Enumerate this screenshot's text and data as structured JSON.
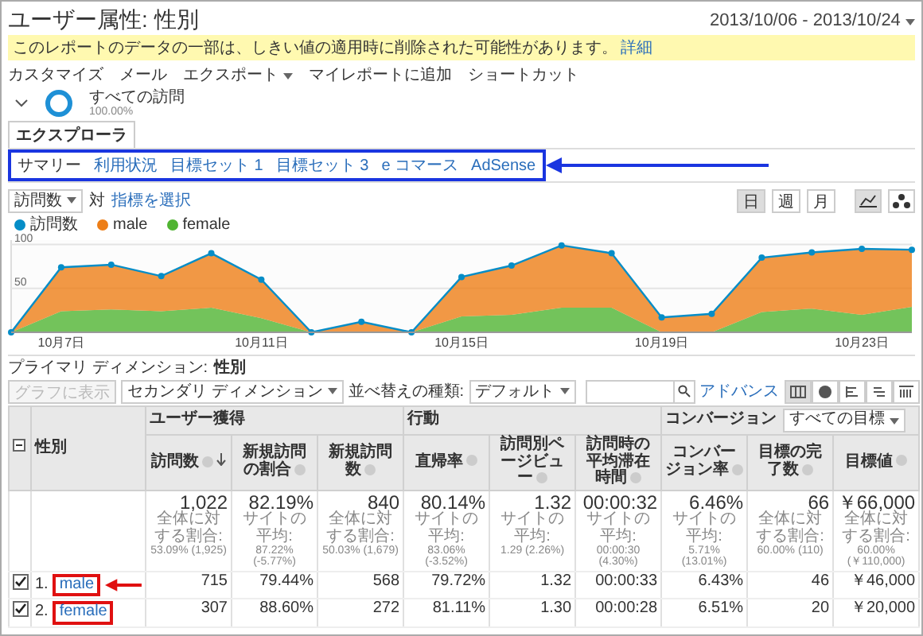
{
  "window_title": "ユーザー属性: 性別",
  "date_range": "2013/10/06 - 2013/10/24",
  "notice": {
    "text": "このレポートのデータの一部は、しきい値の適用時に削除された可能性があります。",
    "link": "詳細"
  },
  "menu": [
    {
      "label": "カスタマイズ",
      "dropdown": false
    },
    {
      "label": "メール",
      "dropdown": false
    },
    {
      "label": "エクスポート",
      "dropdown": true
    },
    {
      "label": "マイレポートに追加",
      "dropdown": false
    },
    {
      "label": "ショートカット",
      "dropdown": false
    }
  ],
  "segment": {
    "name": "すべての訪問",
    "share": "100.00%"
  },
  "explorer_tab": "エクスプローラ",
  "report_tabs": [
    {
      "label": "サマリー",
      "selected": true
    },
    {
      "label": "利用状況",
      "selected": false
    },
    {
      "label": "目標セット 1",
      "selected": false
    },
    {
      "label": "目標セット 3",
      "selected": false
    },
    {
      "label": "e コマース",
      "selected": false
    },
    {
      "label": "AdSense",
      "selected": false
    }
  ],
  "chart_controls": {
    "metric": "訪問数",
    "versus": "対",
    "metric_picker": "指標を選択",
    "periods": [
      {
        "label": "日",
        "selected": true
      },
      {
        "label": "週",
        "selected": false
      },
      {
        "label": "月",
        "selected": false
      }
    ],
    "chart_types": [
      {
        "kind": "line",
        "selected": true
      },
      {
        "kind": "motion",
        "selected": false
      }
    ]
  },
  "total_line": {
    "name": "訪問数",
    "color": "#058dc7"
  },
  "chart_data": {
    "type": "area",
    "stacked": true,
    "categories": [
      null,
      "10月7日",
      null,
      null,
      null,
      "10月11日",
      null,
      null,
      null,
      "10月15日",
      null,
      null,
      null,
      "10月19日",
      null,
      null,
      null,
      "10月23日",
      null
    ],
    "ylim": [
      0,
      105
    ],
    "yticks": [
      50,
      100
    ],
    "series": [
      {
        "name": "male",
        "color": "#ed7e17",
        "values": [
          0,
          50,
          51,
          40,
          62,
          44,
          0,
          12,
          0,
          45,
          56,
          71,
          62,
          17,
          21,
          62,
          64,
          75,
          65
        ]
      },
      {
        "name": "female",
        "color": "#50b432",
        "values": [
          0,
          24,
          26,
          24,
          28,
          16,
          0,
          0,
          0,
          18,
          20,
          28,
          28,
          0,
          0,
          23,
          27,
          20,
          29
        ]
      }
    ]
  },
  "primary_dimension": {
    "label": "プライマリ ディメンション:",
    "value": "性別"
  },
  "table_controls": {
    "plot_button": {
      "label": "グラフに表示",
      "disabled": true
    },
    "secondary_dimension": "セカンダリ ディメンション",
    "sort_label": "並べ替えの種類:",
    "sort_value": "デフォルト",
    "advanced_link": "アドバンス",
    "views": [
      {
        "kind": "table",
        "selected": true
      },
      {
        "kind": "pie",
        "selected": false
      },
      {
        "kind": "bar",
        "selected": false
      },
      {
        "kind": "compare",
        "selected": false
      },
      {
        "kind": "pivot",
        "selected": false
      }
    ]
  },
  "table": {
    "dimension_header": "性別",
    "groups": [
      {
        "label": "ユーザー獲得",
        "columns": [
          {
            "label": "訪問数",
            "sorted": true
          },
          {
            "label": "新規訪問の割合",
            "sorted": false
          },
          {
            "label": "新規訪問数",
            "sorted": false
          }
        ]
      },
      {
        "label": "行動",
        "columns": [
          {
            "label": "直帰率",
            "sorted": false
          },
          {
            "label": "訪問別ページビュー",
            "sorted": false
          },
          {
            "label": "訪問時の平均滞在時間",
            "sorted": false
          }
        ]
      },
      {
        "label": "コンバージョン",
        "select": "すべての目標",
        "columns": [
          {
            "label": "コンバージョン率",
            "sorted": false
          },
          {
            "label": "目標の完了数",
            "sorted": false
          },
          {
            "label": "目標値",
            "sorted": false
          }
        ]
      }
    ],
    "totals": [
      {
        "value": "1,022",
        "note_label": "全体に対する割合:",
        "note_value": "53.09% (1,925)"
      },
      {
        "value": "82.19%",
        "note_label": "サイトの平均:",
        "note_value": "87.22% (-5.77%)"
      },
      {
        "value": "840",
        "note_label": "全体に対する割合:",
        "note_value": "50.03% (1,679)"
      },
      {
        "value": "80.14%",
        "note_label": "サイトの平均:",
        "note_value": "83.06% (-3.52%)"
      },
      {
        "value": "1.32",
        "note_label": "サイトの平均:",
        "note_value": "1.29 (2.26%)"
      },
      {
        "value": "00:00:32",
        "note_label": "サイトの平均:",
        "note_value": "00:00:30 (4.30%)"
      },
      {
        "value": "6.46%",
        "note_label": "サイトの平均:",
        "note_value": "5.71% (13.01%)"
      },
      {
        "value": "66",
        "note_label": "全体に対する割合:",
        "note_value": "60.00% (110)"
      },
      {
        "value": "￥66,000",
        "note_label": "全体に対する割合:",
        "note_value": "60.00% (￥110,000)"
      }
    ],
    "rows": [
      {
        "index": "1.",
        "name": "male",
        "checked": true,
        "cells": [
          "715",
          "79.44%",
          "568",
          "79.72%",
          "1.32",
          "00:00:33",
          "6.43%",
          "46",
          "￥46,000"
        ]
      },
      {
        "index": "2.",
        "name": "female",
        "checked": true,
        "cells": [
          "307",
          "88.60%",
          "272",
          "81.11%",
          "1.30",
          "00:00:28",
          "6.51%",
          "20",
          "￥20,000"
        ]
      }
    ]
  }
}
